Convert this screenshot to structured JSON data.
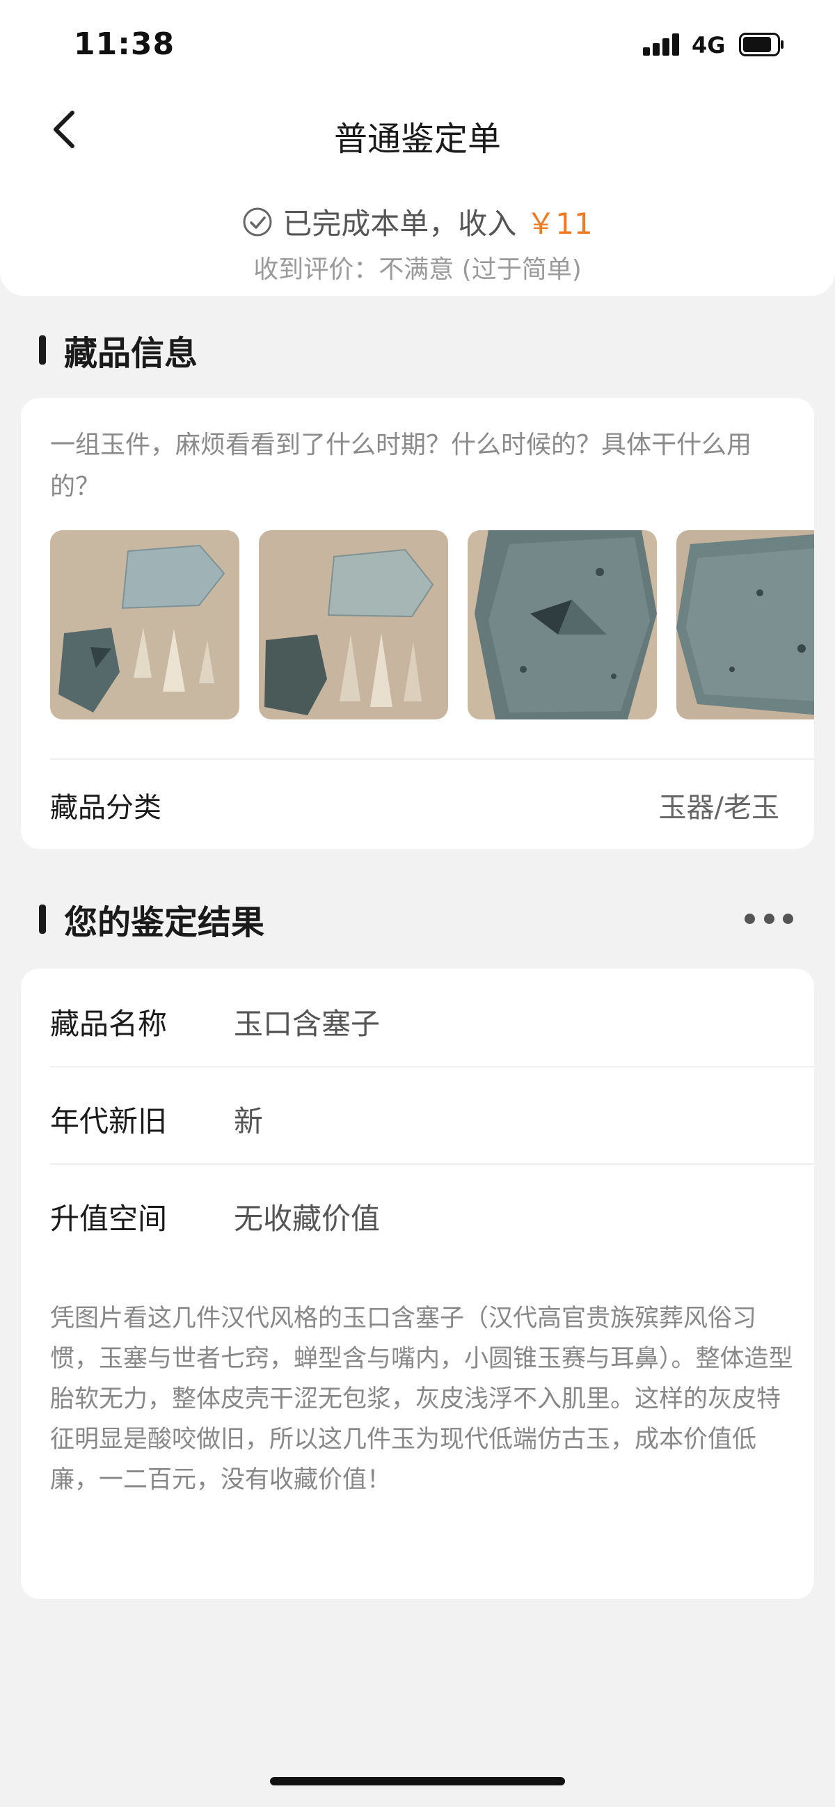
{
  "status_bar": {
    "time": "11:38",
    "network": "4G"
  },
  "nav": {
    "title": "普通鉴定单"
  },
  "order": {
    "status_text": "已完成本单，收入",
    "income": "￥11",
    "rating": "收到评价：不满意 (过于简单)"
  },
  "collection_section": {
    "heading": "藏品信息",
    "question": "一组玉件，麻烦看看到了什么时期？什么时候的？具体干什么用的？",
    "category_label": "藏品分类",
    "category_value": "玉器/老玉",
    "photos": [
      "jade-set-photo",
      "jade-set-photo",
      "jade-closeup-photo",
      "jade-closeup-photo"
    ]
  },
  "result_section": {
    "heading": "您的鉴定结果",
    "rows": [
      {
        "label": "藏品名称",
        "value": "玉口含塞子"
      },
      {
        "label": "年代新旧",
        "value": "新"
      },
      {
        "label": "升值空间",
        "value": "无收藏价值"
      }
    ],
    "comment": "凭图片看这几件汉代风格的玉口含塞子（汉代高官贵族殡葬风俗习惯，玉塞与世者七窍，蝉型含与嘴内，小圆锥玉赛与耳鼻）。整体造型胎软无力，整体皮壳干涩无包浆，灰皮浅浮不入肌里。这样的灰皮特征明显是酸咬做旧，所以这几件玉为现代低端仿古玉，成本价值低廉，一二百元，没有收藏价值！"
  },
  "colors": {
    "accent": "#f07a22",
    "page_bg": "#f2f2f2",
    "card_bg": "#ffffff"
  }
}
